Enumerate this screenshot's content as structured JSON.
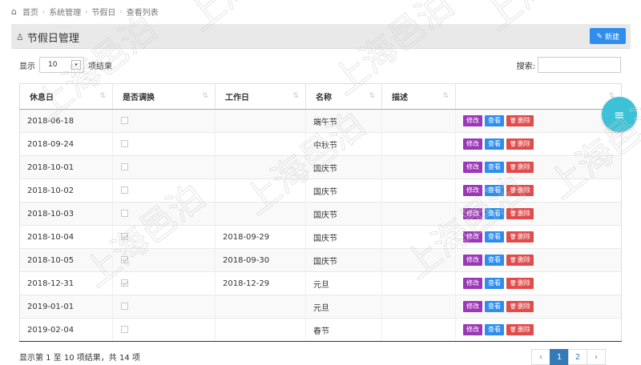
{
  "breadcrumb": [
    "首页",
    "系统管理",
    "节假日",
    "查看列表"
  ],
  "page": {
    "title": "节假日管理",
    "new_label": "新建"
  },
  "length": {
    "prefix": "显示",
    "value": "10",
    "suffix": "项结果"
  },
  "search": {
    "label": "搜索:",
    "value": ""
  },
  "table": {
    "headers": [
      "休息日",
      "是否调换",
      "工作日",
      "名称",
      "描述",
      ""
    ],
    "actions": {
      "edit": "修改",
      "view": "查看",
      "delete": "删除"
    },
    "rows": [
      {
        "date": "2018-06-18",
        "swapped": false,
        "workday": "",
        "name": "端午节",
        "desc": ""
      },
      {
        "date": "2018-09-24",
        "swapped": false,
        "workday": "",
        "name": "中秋节",
        "desc": ""
      },
      {
        "date": "2018-10-01",
        "swapped": false,
        "workday": "",
        "name": "国庆节",
        "desc": ""
      },
      {
        "date": "2018-10-02",
        "swapped": false,
        "workday": "",
        "name": "国庆节",
        "desc": ""
      },
      {
        "date": "2018-10-03",
        "swapped": false,
        "workday": "",
        "name": "国庆节",
        "desc": ""
      },
      {
        "date": "2018-10-04",
        "swapped": true,
        "workday": "2018-09-29",
        "name": "国庆节",
        "desc": ""
      },
      {
        "date": "2018-10-05",
        "swapped": true,
        "workday": "2018-09-30",
        "name": "国庆节",
        "desc": ""
      },
      {
        "date": "2018-12-31",
        "swapped": true,
        "workday": "2018-12-29",
        "name": "元旦",
        "desc": ""
      },
      {
        "date": "2019-01-01",
        "swapped": false,
        "workday": "",
        "name": "元旦",
        "desc": ""
      },
      {
        "date": "2019-02-04",
        "swapped": false,
        "workday": "",
        "name": "春节",
        "desc": ""
      }
    ]
  },
  "info": "显示第 1 至 10 项结果，共 14 项",
  "pagination": {
    "prev": "‹",
    "pages": [
      "1",
      "2"
    ],
    "current": "1",
    "next": "›"
  },
  "watermark": "上海邑泊",
  "colors": {
    "edit": "#9b38b5",
    "view": "#2e8ded",
    "delete": "#e04b4b",
    "fab": "#3cc1d6",
    "primary": "#337ab7"
  }
}
